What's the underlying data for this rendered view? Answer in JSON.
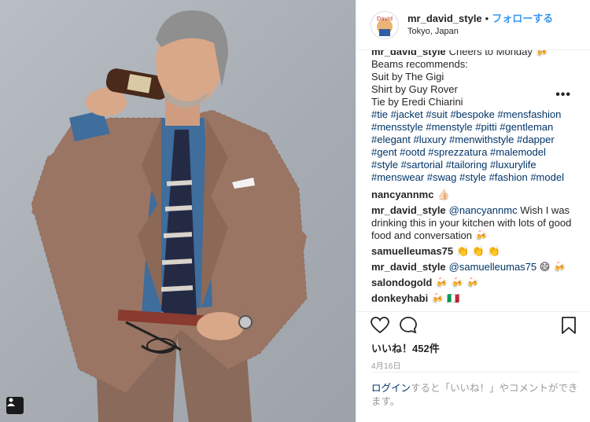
{
  "header": {
    "username": "mr_david_style",
    "separator": "•",
    "follow_label": "フォローする",
    "location": "Tokyo, Japan"
  },
  "caption": {
    "username": "mr_david_style",
    "first_line": "Cheers to Monday 🍻",
    "lines": [
      "Beams recommends:",
      "Suit by The Gigi",
      "Shirt by Guy Rover",
      "Tie by Eredi Chiarini"
    ],
    "hashtag_lines": [
      "#tie #jacket #suit #bespoke #mensfashion",
      "#mensstyle #menstyle #pitti #gentleman",
      "#elegant #luxury #menwithstyle #dapper",
      "#gent #ootd #sprezzatura #malemodel",
      "#style #sartorial #tailoring #luxurylife",
      "#menswear #swag #style #fashion #model"
    ]
  },
  "comments": [
    {
      "user": "nancyannmc",
      "text": "👍🏻"
    },
    {
      "user": "mr_david_style",
      "mention": "@nancyannmc",
      "text": "Wish I was drinking this in your kitchen with lots of good food and conversation 🍻"
    },
    {
      "user": "samuelleumas75",
      "text": "👏 👏 👏"
    },
    {
      "user": "mr_david_style",
      "mention": "@samuelleumas75",
      "text": "😄 🍻"
    },
    {
      "user": "salondogold",
      "text": "🍻 🍻 🍻"
    },
    {
      "user": "donkeyhabi",
      "text": "🍻 🇮🇹"
    }
  ],
  "actions": {
    "like_icon": "heart-icon",
    "comment_icon": "comment-icon",
    "save_icon": "bookmark-icon",
    "likes_text": "いいね！452件",
    "date": "4月16日"
  },
  "login": {
    "link_text": "ログイン",
    "rest_text": "すると「いいね！」やコメントができます。",
    "more_label": "•••"
  },
  "colors": {
    "follow": "#3897f0",
    "hashtag": "#003569",
    "meta": "#999999"
  }
}
